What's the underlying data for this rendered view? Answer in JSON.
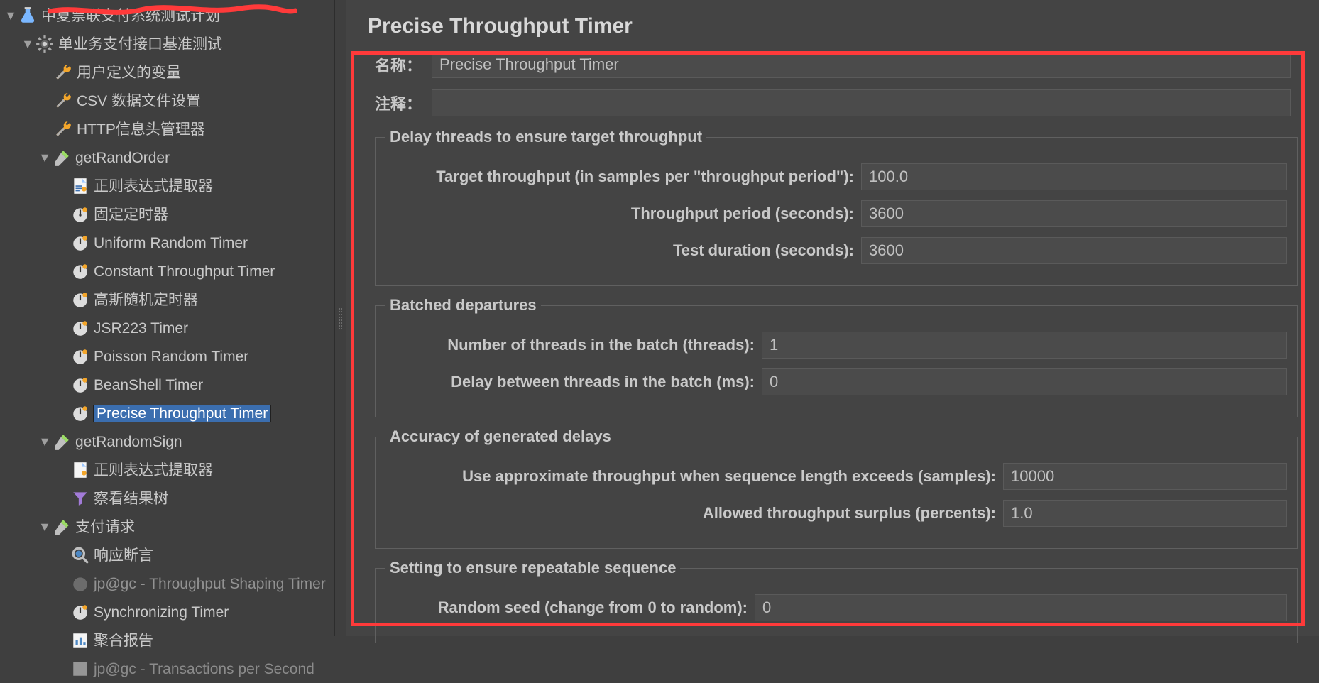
{
  "tree": {
    "root": "中夏票联支付系统测试计划",
    "threadgroup": "单业务支付接口基准测试",
    "udv": "用户定义的变量",
    "csv": "CSV 数据文件设置",
    "headermgr": "HTTP信息头管理器",
    "s1": "getRandOrder",
    "s1_regex": "正则表达式提取器",
    "t_const": "固定定时器",
    "t_urand": "Uniform Random Timer",
    "t_cth": "Constant Throughput Timer",
    "t_gauss": "高斯随机定时器",
    "t_jsr": "JSR223 Timer",
    "t_pois": "Poisson Random Timer",
    "t_bean": "BeanShell Timer",
    "t_prec": "Precise Throughput Timer",
    "s2": "getRandomSign",
    "s2_regex": "正则表达式提取器",
    "s2_view": "察看结果树",
    "s3": "支付请求",
    "s3_assert": "响应断言",
    "s3_shaping": "jp@gc - Throughput Shaping Timer",
    "s3_sync": "Synchronizing Timer",
    "s3_agg": "聚合报告",
    "s3_tps": "jp@gc - Transactions per Second"
  },
  "header": {
    "title": "Precise Throughput Timer",
    "name_label": "名称：",
    "name_value": "Precise Throughput Timer",
    "comment_label": "注释："
  },
  "group1": {
    "legend": "Delay threads to ensure target throughput",
    "l_target": "Target throughput (in samples per \"throughput period\"):",
    "v_target": "100.0",
    "l_period": "Throughput period (seconds):",
    "v_period": "3600",
    "l_dur": "Test duration (seconds):",
    "v_dur": "3600"
  },
  "group2": {
    "legend": "Batched departures",
    "l_batch": "Number of threads in the batch (threads):",
    "v_batch": "1",
    "l_delay": "Delay between threads in the batch (ms):",
    "v_delay": "0"
  },
  "group3": {
    "legend": "Accuracy of generated delays",
    "l_approx": "Use approximate throughput when sequence length exceeds (samples):",
    "v_approx": "10000",
    "l_surp": "Allowed throughput surplus (percents):",
    "v_surp": "1.0"
  },
  "group4": {
    "legend": "Setting to ensure repeatable sequence",
    "l_seed": "Random seed (change from 0 to random):",
    "v_seed": "0"
  }
}
